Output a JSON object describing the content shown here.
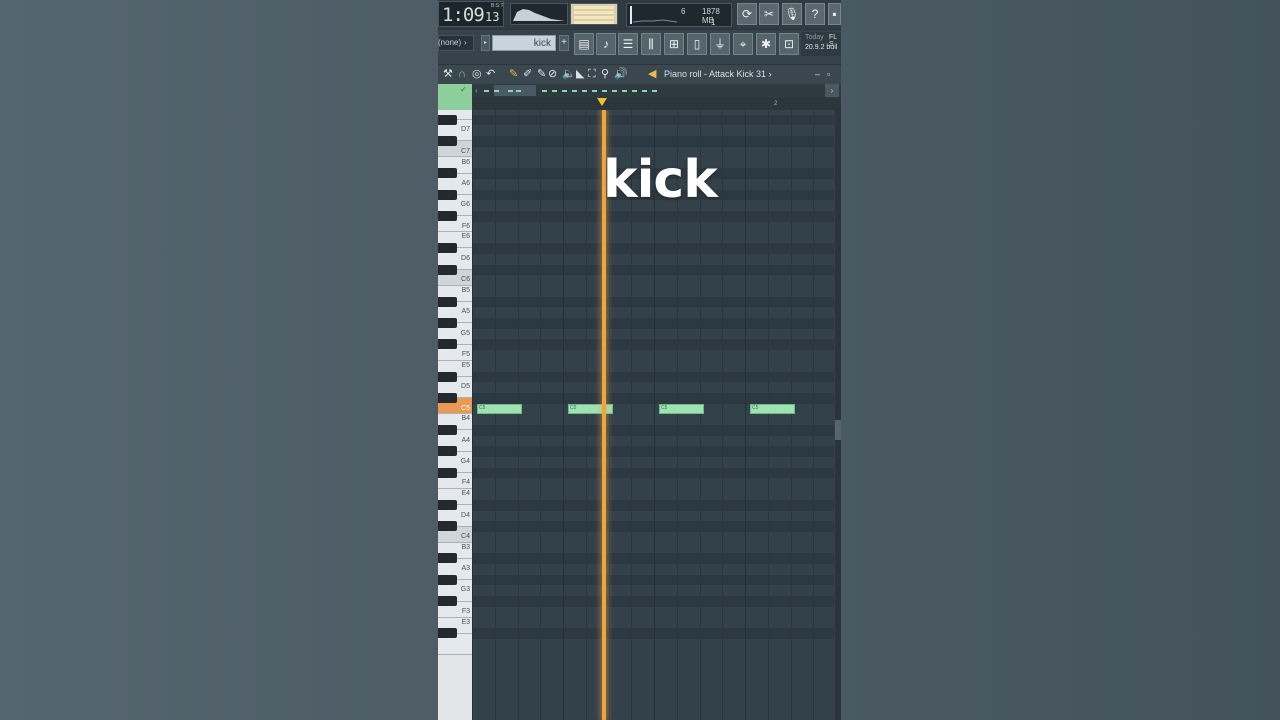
{
  "transport": {
    "time_main": "1:09",
    "time_sec": "13",
    "time_unit": "B:S:T"
  },
  "monitor": {
    "cpu": "6",
    "memory": "1878 MB",
    "polyphony": "1"
  },
  "toolbar": {
    "pattern": "(none)",
    "pattern_arrow": "›",
    "channel": "kick",
    "icons": [
      "undo-icon",
      "cut-icon",
      "mic-icon",
      "help-icon",
      "save-icon"
    ],
    "window_icons": [
      "playlist-icon",
      "piano-roll-icon",
      "channel-rack-icon",
      "mixer-icon",
      "browser-icon",
      "file-icon",
      "plugin-icon",
      "pin-icon",
      "bug-icon",
      "shop-icon"
    ]
  },
  "news": {
    "today": "Today",
    "product": "FL S",
    "build": "20.9.2 buil"
  },
  "piano_roll": {
    "title": "Piano roll - Attack Kick 31",
    "title_arrow": "›",
    "bar_marker": "2",
    "keys": [
      "E7",
      "D7",
      "C7",
      "B6",
      "A6",
      "G6",
      "F6",
      "E6",
      "D6",
      "C6",
      "B5",
      "A5",
      "G5",
      "F5",
      "E5",
      "D5",
      "C5",
      "B4",
      "A4",
      "G4",
      "F4",
      "E4",
      "D4",
      "C4",
      "B3",
      "A3",
      "G3",
      "F3",
      "E3"
    ],
    "active_key": "C5",
    "notes": [
      {
        "label": "C5",
        "pitch": "C5",
        "start_step": 1
      },
      {
        "label": "C5",
        "pitch": "C5",
        "start_step": 5
      },
      {
        "label": "C5",
        "pitch": "C5",
        "start_step": 9
      },
      {
        "label": "C5",
        "pitch": "C5",
        "start_step": 13
      }
    ]
  },
  "overlay": {
    "caption": "kick"
  },
  "colors": {
    "note": "#9fe2b2",
    "playhead": "#f0a440",
    "active_key": "#e89a52",
    "accent_green": "#8ccf9c"
  }
}
